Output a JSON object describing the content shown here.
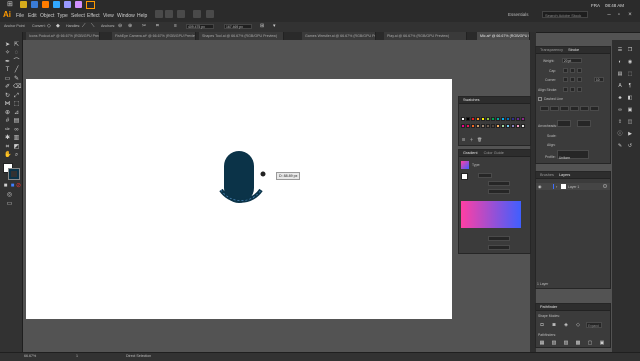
{
  "app": {
    "logo": "Ai",
    "workspace": "Essentials",
    "search_placeholder": "Search Adobe Stock",
    "locale": "FRA",
    "clock": "08:48 AM"
  },
  "menu": [
    "File",
    "Edit",
    "Object",
    "Type",
    "Select",
    "Effect",
    "View",
    "Window",
    "Help"
  ],
  "control_bar": {
    "selection": "Anchor Point",
    "convert": "Convert:",
    "handles": "Handles:",
    "anchors": "Anchors:",
    "x_value": "409.475 px",
    "y_value": "167.469 px"
  },
  "tabs": [
    {
      "label": "Icons Podcut.ai* @ 66.67% (RGB/GPU Preview)",
      "active": false
    },
    {
      "label": "FishEye Camera.ai* @ 66.67% (RGB/GPU Preview)",
      "active": false
    },
    {
      "label": "Shapes Tool.ai @ 66.67% (RGB/GPU Preview)",
      "active": false
    },
    {
      "label": "Games Wrestler.ai @ 66.67% (RGB/GPU Preview)",
      "active": false
    },
    {
      "label": "Play.ai @ 66.67% (RGB/GPU Preview)",
      "active": false
    },
    {
      "label": "Mic.ai* @ 66.67% (RGB/GPU Preview)",
      "active": true
    }
  ],
  "canvas": {
    "tooltip": "D: 88.89 px",
    "mic_color": "#0b3348"
  },
  "status": {
    "zoom": "66.67%",
    "page": "1",
    "mode": "Direct Selection"
  },
  "transparency_panel": {
    "tab1": "Transparency",
    "tab2": "Stroke"
  },
  "stroke_panel": {
    "weight_label": "Weight:",
    "weight_value": "20 pt",
    "cap_label": "Cap:",
    "corner_label": "Corner:",
    "limit_value": "10",
    "align_label": "Align Stroke:",
    "dashed_label": "Dashed Line",
    "arrowheads_label": "Arrowheads:",
    "scale_label": "Scale:",
    "align2_label": "Align:",
    "profile_label": "Profile:",
    "profile_value": "Uniform"
  },
  "swatches_panel": {
    "title": "Swatches"
  },
  "swatch_colors": [
    "#ffffff",
    "#000000",
    "#ed1c24",
    "#f7941d",
    "#fff200",
    "#8dc63f",
    "#00a651",
    "#00a99d",
    "#00aeef",
    "#0072bc",
    "#2e3192",
    "#662d91",
    "#92278f",
    "#ec008c",
    "#ed145b",
    "#f26522",
    "#c69c6d",
    "#998675",
    "#736357",
    "#534741",
    "#fbaf5d",
    "#a3d39c",
    "#6dcff6",
    "#8781bd",
    "#f49ac1",
    "#e6e6e6"
  ],
  "gradient_panel": {
    "title": "Gradient",
    "tab2": "Color Guide",
    "type_label": "Type:",
    "gradient_start": "#ff3fa4",
    "gradient_end": "#3f5fff"
  },
  "layers_panel": {
    "tab1": "Brushes",
    "tab2": "Layers",
    "layer_name": "Layer 1",
    "footer": "1 Layer"
  },
  "pathfinder_panel": {
    "title": "Pathfinder",
    "shape_modes": "Shape Modes:",
    "pathfinders": "Pathfinders:",
    "expand": "Expand"
  }
}
